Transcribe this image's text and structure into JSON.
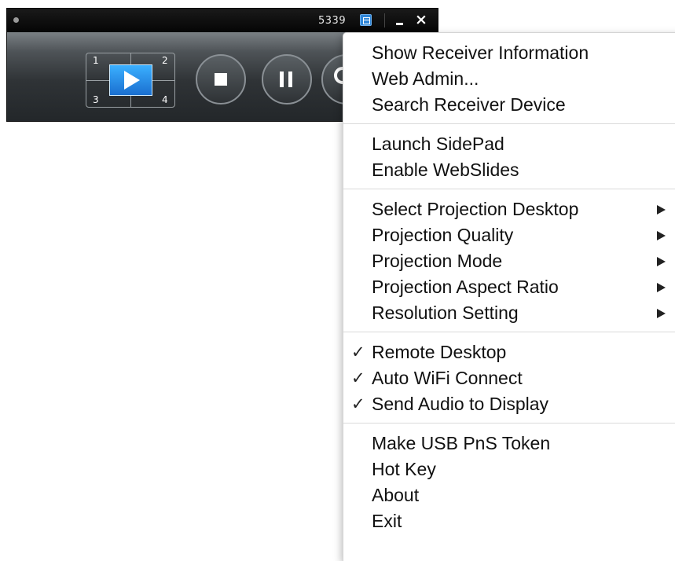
{
  "toolbar": {
    "code": "5339",
    "quadrants": [
      "1",
      "2",
      "3",
      "4"
    ],
    "icons": {
      "info": "info-icon",
      "minimize": "minimize-icon",
      "close": "close-icon",
      "play": "play-icon",
      "stop": "stop-icon",
      "pause": "pause-icon",
      "search": "search-icon"
    },
    "close_glyph": "×"
  },
  "menu": {
    "sections": [
      {
        "items": [
          {
            "label": "Show Receiver Information"
          },
          {
            "label": "Web Admin..."
          },
          {
            "label": "Search Receiver Device"
          }
        ]
      },
      {
        "items": [
          {
            "label": "Launch SidePad"
          },
          {
            "label": "Enable WebSlides"
          }
        ]
      },
      {
        "items": [
          {
            "label": "Select Projection Desktop",
            "submenu": true
          },
          {
            "label": "Projection Quality",
            "submenu": true
          },
          {
            "label": "Projection Mode",
            "submenu": true
          },
          {
            "label": "Projection Aspect Ratio",
            "submenu": true
          },
          {
            "label": "Resolution Setting",
            "submenu": true
          }
        ]
      },
      {
        "items": [
          {
            "label": "Remote Desktop",
            "checked": true,
            "check": "✓"
          },
          {
            "label": "Auto WiFi Connect",
            "checked": true,
            "check": "✓"
          },
          {
            "label": "Send Audio to Display",
            "checked": true,
            "check": "✓"
          }
        ]
      },
      {
        "items": [
          {
            "label": "Make USB PnS Token"
          },
          {
            "label": "Hot Key"
          },
          {
            "label": "About"
          },
          {
            "label": "Exit"
          }
        ]
      }
    ]
  },
  "colors": {
    "accent": "#2f86d8",
    "play_button": "#1a8ae8"
  }
}
